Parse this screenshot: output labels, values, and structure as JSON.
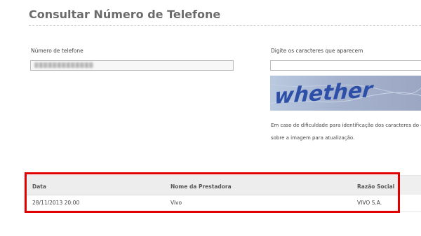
{
  "page": {
    "title": "Consultar Número de Telefone"
  },
  "form": {
    "phone_label": "Número de telefone",
    "phone_value": "",
    "captcha_label": "Digite os caracteres que aparecem",
    "captcha_value": "",
    "captcha_word": "whether",
    "help_line1": "Em caso de dificuldade para identificação dos caracteres do códig",
    "help_line2": "sobre a imagem para atualização."
  },
  "results": {
    "columns": [
      "Data",
      "Nome da Prestadora",
      "Razão Social"
    ],
    "rows": [
      [
        "28/11/2013 20:00",
        "Vivo",
        "VIVO S.A."
      ]
    ]
  },
  "colors": {
    "highlight": "#e00000",
    "title": "#6b6b6b",
    "captcha_text": "#2d4fa8"
  }
}
